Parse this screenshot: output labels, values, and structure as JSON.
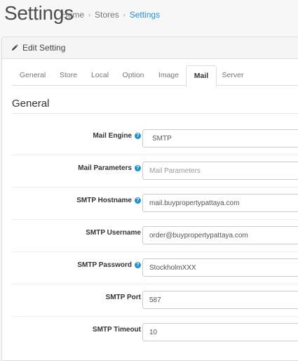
{
  "header": {
    "title": "Settings",
    "breadcrumb": [
      "Home",
      "Stores",
      "Settings"
    ]
  },
  "panel": {
    "heading": "Edit Setting",
    "tabs": [
      "General",
      "Store",
      "Local",
      "Option",
      "Image",
      "Mail",
      "Server"
    ],
    "active_tab": "Mail"
  },
  "section": {
    "legend": "General"
  },
  "fields": [
    {
      "label": "Mail Engine",
      "help": true,
      "value": "SMTP",
      "type": "select"
    },
    {
      "label": "Mail Parameters",
      "help": true,
      "value": "",
      "placeholder": "Mail Parameters",
      "type": "text"
    },
    {
      "label": "SMTP Hostname",
      "help": true,
      "value": "mail.buypropertypattaya.com",
      "type": "text"
    },
    {
      "label": "SMTP Username",
      "help": false,
      "value": "order@buypropertypattaya.com",
      "type": "text"
    },
    {
      "label": "SMTP Password",
      "help": true,
      "value": "StockholmXXX",
      "type": "text"
    },
    {
      "label": "SMTP Port",
      "help": false,
      "value": "587",
      "type": "text"
    },
    {
      "label": "SMTP Timeout",
      "help": false,
      "value": "10",
      "type": "text"
    }
  ],
  "colors": {
    "link": "#1e91cf",
    "help_icon": "#1e91cf"
  }
}
